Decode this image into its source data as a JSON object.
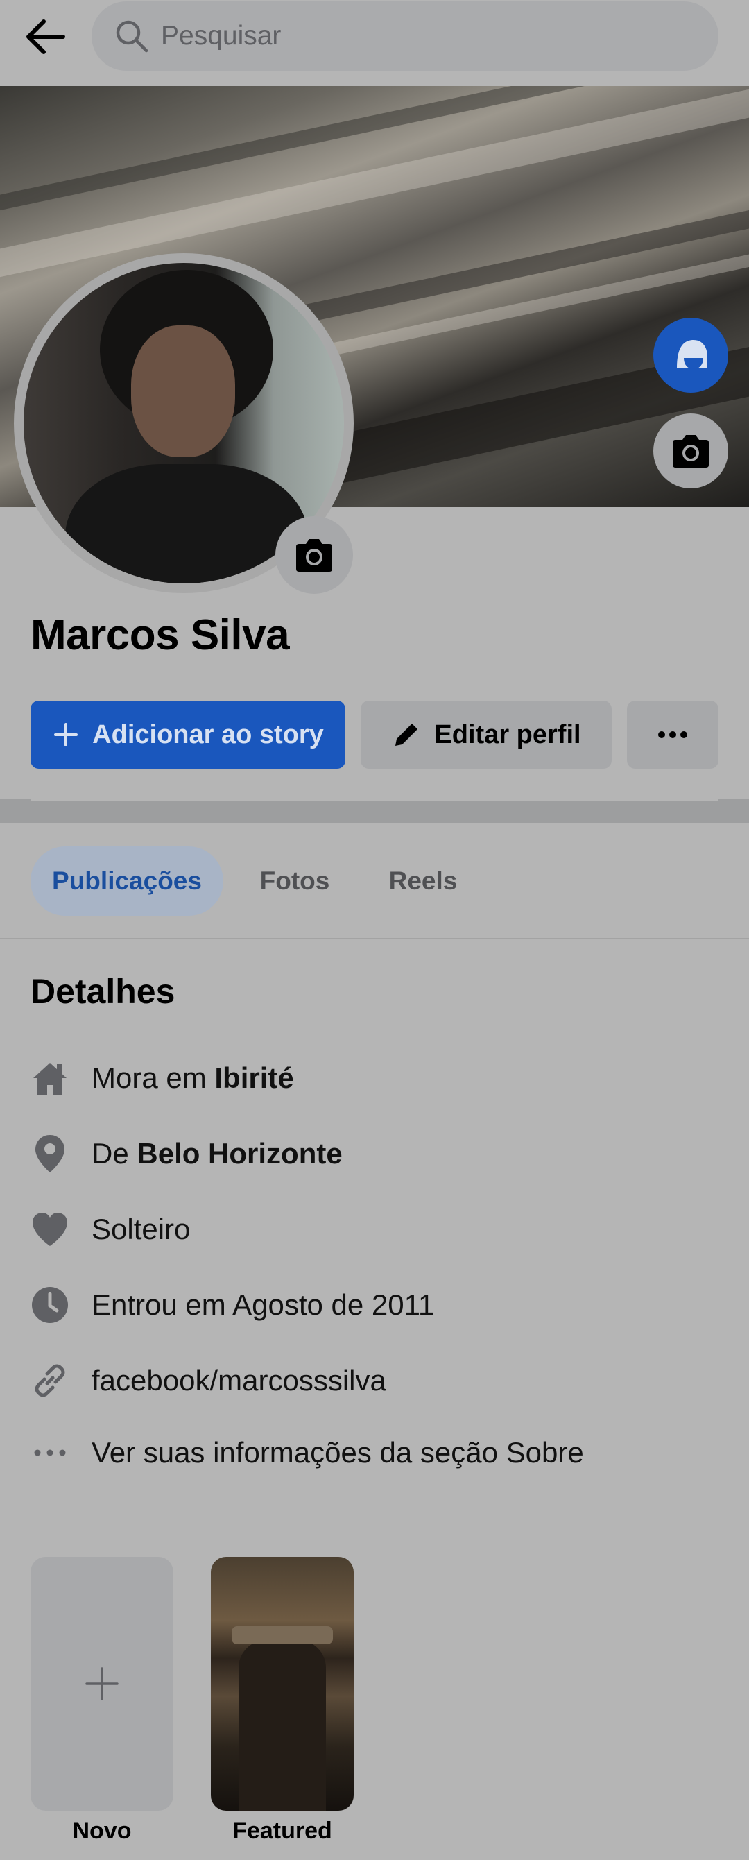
{
  "search": {
    "placeholder": "Pesquisar"
  },
  "profile": {
    "name": "Marcos Silva"
  },
  "actions": {
    "add_story": "Adicionar ao story",
    "edit_profile": "Editar perfil"
  },
  "tabs": [
    {
      "label": "Publicações",
      "active": true
    },
    {
      "label": "Fotos",
      "active": false
    },
    {
      "label": "Reels",
      "active": false
    }
  ],
  "details": {
    "title": "Detalhes",
    "lives_in_prefix": "Mora em",
    "lives_in_place": "Ibirité",
    "from_prefix": "De",
    "from_place": "Belo Horizonte",
    "relationship": "Solteiro",
    "joined": "Entrou em Agosto de 2011",
    "link": "facebook/marcosssilva",
    "see_about": "Ver suas informações da seção Sobre"
  },
  "featured": {
    "new_label": "Novo",
    "collection_label": "Featured"
  },
  "colors": {
    "accent": "#1a57bd",
    "background": "#b5b5b5",
    "active_tab_bg": "#a8b4c6"
  },
  "icons": {
    "back": "arrow-left-icon",
    "search": "search-icon",
    "avatar": "avatar-icon",
    "camera": "camera-icon",
    "plus": "plus-icon",
    "pencil": "pencil-icon",
    "more": "more-horizontal-icon",
    "home": "home-icon",
    "location": "location-pin-icon",
    "heart": "heart-icon",
    "clock": "clock-icon",
    "link": "link-icon"
  }
}
